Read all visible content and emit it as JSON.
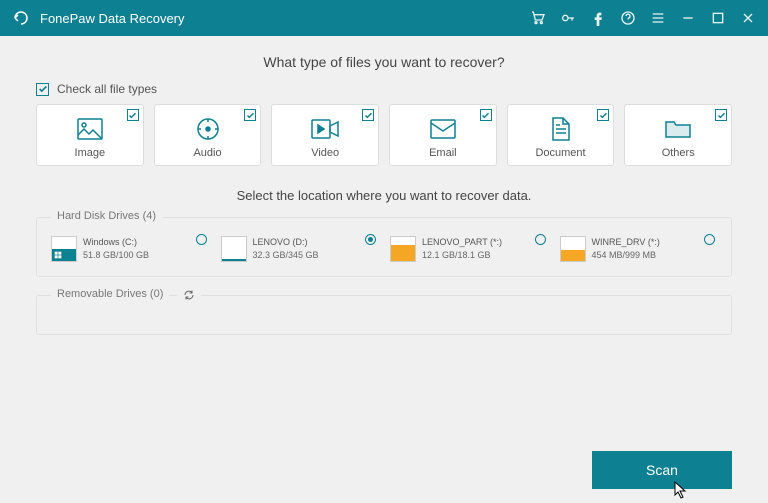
{
  "titlebar": {
    "title": "FonePaw Data Recovery"
  },
  "heading1": "What type of files you want to recover?",
  "check_all_label": "Check all file types",
  "types": [
    {
      "label": "Image",
      "icon": "image-icon"
    },
    {
      "label": "Audio",
      "icon": "audio-icon"
    },
    {
      "label": "Video",
      "icon": "video-icon"
    },
    {
      "label": "Email",
      "icon": "email-icon"
    },
    {
      "label": "Document",
      "icon": "document-icon"
    },
    {
      "label": "Others",
      "icon": "folder-icon"
    }
  ],
  "heading2": "Select the location where you want to recover data.",
  "hard_drives": {
    "title": "Hard Disk Drives (4)",
    "items": [
      {
        "name": "Windows (C:)",
        "size": "51.8 GB/100 GB",
        "fill_pct": 52,
        "fill_color": "#0d8091",
        "win": true,
        "selected": false
      },
      {
        "name": "LENOVO (D:)",
        "size": "32.3 GB/345 GB",
        "fill_pct": 10,
        "fill_color": "#0d8091",
        "win": false,
        "selected": true
      },
      {
        "name": "LENOVO_PART (*:)",
        "size": "12.1 GB/18.1 GB",
        "fill_pct": 67,
        "fill_color": "#f5a623",
        "win": false,
        "selected": false
      },
      {
        "name": "WINRE_DRV (*:)",
        "size": "454 MB/999 MB",
        "fill_pct": 46,
        "fill_color": "#f5a623",
        "win": false,
        "selected": false
      }
    ]
  },
  "removable_drives": {
    "title": "Removable Drives (0)"
  },
  "scan_label": "Scan"
}
